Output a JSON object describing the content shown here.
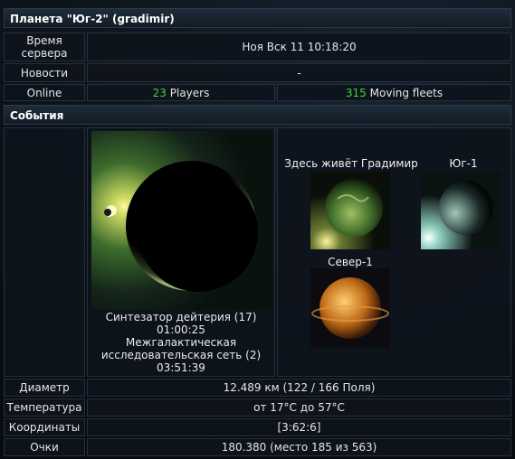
{
  "title": "Планета \"Юг-2\" (gradimir)",
  "rows": {
    "server_time": {
      "label": "Время сервера",
      "value": "Ноя Вск 11 10:18:20"
    },
    "news": {
      "label": "Новости",
      "value": "-"
    },
    "online": {
      "label": "Online",
      "players_count": "23",
      "players_label": "Players",
      "fleets_count": "315",
      "fleets_label": "Moving fleets"
    }
  },
  "events_header": "События",
  "build_queue": [
    {
      "name": "Синтезатор дейтерия (17)",
      "time": "01:00:25"
    },
    {
      "name": "Межгалактическая исследовательская сеть (2)",
      "time": "03:51:39"
    }
  ],
  "other_planets": [
    {
      "name": "Здесь живёт Градимир",
      "icon": "planet-green-icon"
    },
    {
      "name": "Юг-1",
      "icon": "planet-moon-icon"
    },
    {
      "name": "Север-1",
      "icon": "planet-orange-icon"
    }
  ],
  "info": {
    "diameter": {
      "label": "Диаметр",
      "value": "12.489 км (122 / 166 Поля)"
    },
    "temperature": {
      "label": "Температура",
      "value": "от 17°C до 57°C"
    },
    "coordinates": {
      "label": "Координаты",
      "value": "[3:62:6]"
    },
    "points": {
      "label": "Очки",
      "value": "180.380 (место 185 из 563)"
    }
  },
  "colors": {
    "accent_green": "#33dd33",
    "header_bg": "#1a2531"
  }
}
